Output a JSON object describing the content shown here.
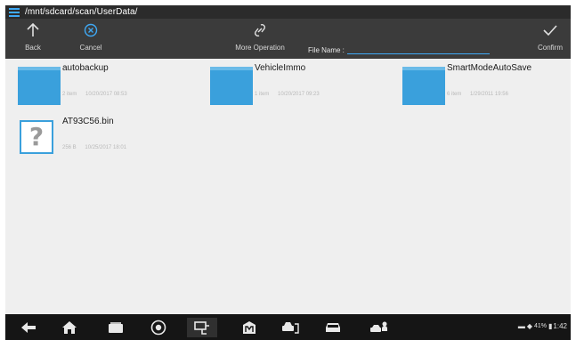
{
  "pathbar": {
    "path": "/mnt/sdcard/scan/UserData/"
  },
  "toolbar": {
    "back_label": "Back",
    "cancel_label": "Cancel",
    "more_label": "More Operation",
    "filename_label": "File Name :",
    "filename_value": "",
    "confirm_label": "Confirm"
  },
  "files": [
    {
      "name": "autobackup",
      "type": "folder",
      "count": "2 item",
      "date": "10/20/2017 08:53"
    },
    {
      "name": "VehicleImmo",
      "type": "folder",
      "count": "1 item",
      "date": "10/20/2017 09:23"
    },
    {
      "name": "SmartModeAutoSave",
      "type": "folder",
      "count": "6 item",
      "date": "1/29/2011 19:56"
    },
    {
      "name": "AT93C56.bin",
      "type": "file",
      "count": "256 B",
      "date": "10/25/2017 18:01"
    }
  ],
  "navbar": {
    "icons": [
      "back-arrow-icon",
      "home-icon",
      "recent-apps-icon",
      "browser-icon",
      "vci-connect-icon",
      "maintenance-icon",
      "vehicle-service-icon",
      "car-icon",
      "remote-expert-icon"
    ]
  },
  "status": {
    "battery": "41%",
    "time": "1:42"
  },
  "colors": {
    "accent": "#3fa9f5",
    "folder": "#3aa0dc",
    "toolbar": "#3b3b3b",
    "navbar": "#151515",
    "content_bg": "#efefef"
  }
}
